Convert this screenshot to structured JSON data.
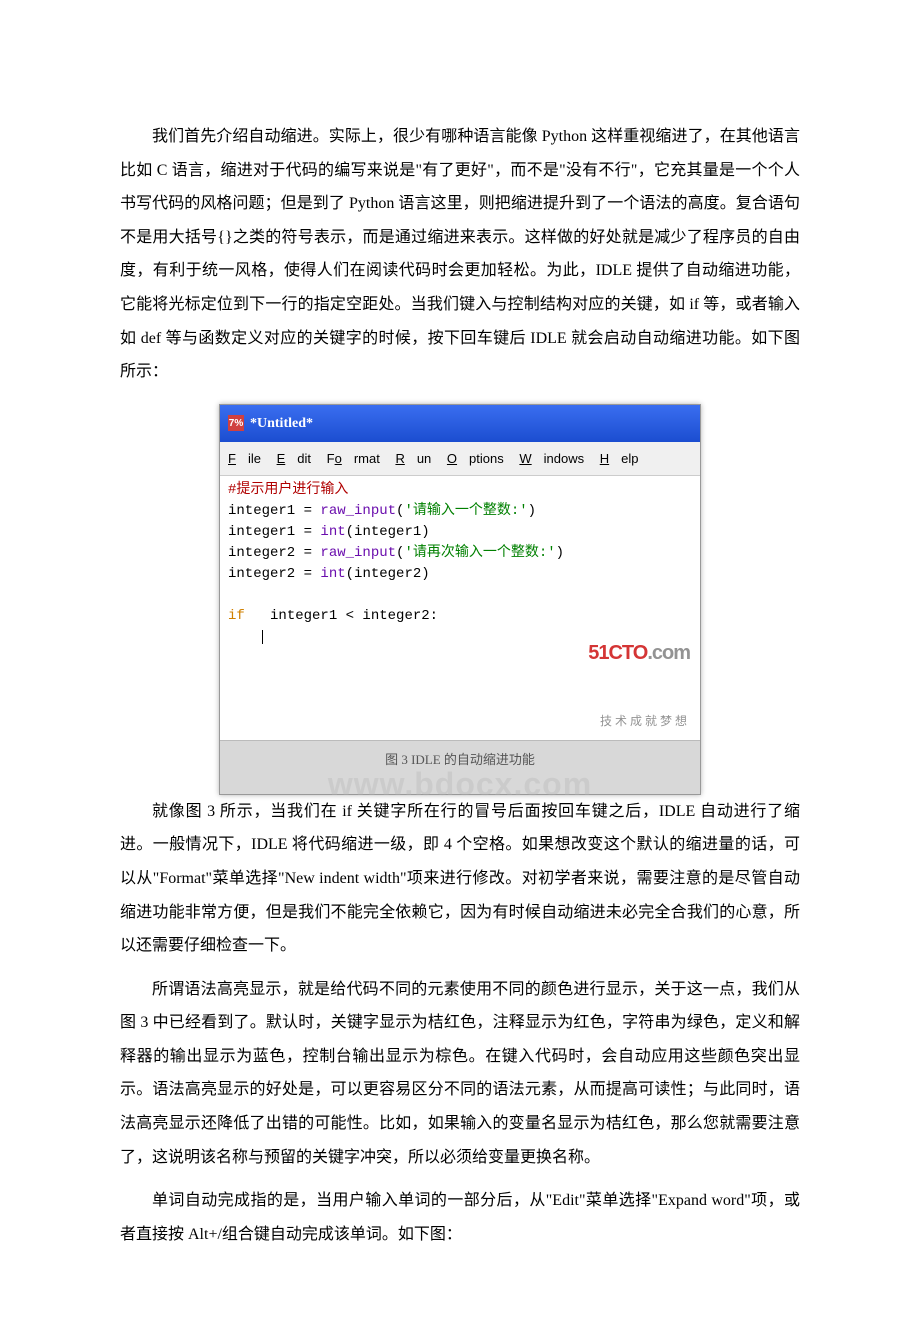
{
  "para1": "我们首先介绍自动缩进。实际上，很少有哪种语言能像 Python 这样重视缩进了，在其他语言比如 C 语言，缩进对于代码的编写来说是\"有了更好\"，而不是\"没有不行\"，它充其量是一个个人书写代码的风格问题；但是到了 Python 语言这里，则把缩进提升到了一个语法的高度。复合语句不是用大括号{}之类的符号表示，而是通过缩进来表示。这样做的好处就是减少了程序员的自由度，有利于统一风格，使得人们在阅读代码时会更加轻松。为此，IDLE 提供了自动缩进功能，它能将光标定位到下一行的指定空距处。当我们键入与控制结构对应的关键，如 if 等，或者输入如 def 等与函数定义对应的关键字的时候，按下回车键后 IDLE 就会启动自动缩进功能。如下图所示：",
  "idle": {
    "title": "*Untitled*",
    "menu": {
      "file": "File",
      "edit": "Edit",
      "format": "Format",
      "run": "Run",
      "options": "Options",
      "windows": "Windows",
      "help": "Help"
    },
    "code": {
      "comment": "#提示用户进行输入",
      "l2a": "integer1 = ",
      "l2b": "raw_input",
      "l2c": "(",
      "l2d": "'请输入一个整数:'",
      "l2e": ")",
      "l3a": "integer1 = ",
      "l3b": "int",
      "l3c": "(integer1)",
      "l4a": "integer2 = ",
      "l4b": "raw_input",
      "l4c": "(",
      "l4d": "'请再次输入一个整数:'",
      "l4e": ")",
      "l5a": "integer2 = ",
      "l5b": "int",
      "l5c": "(integer2)",
      "l7a": "if",
      "l7b": "   integer1 < integer2:"
    },
    "logo1a": "51CTO",
    "logo1b": ".com",
    "logo2": "技术成就梦想",
    "caption": "图 3    IDLE 的自动缩进功能",
    "watermark": "www.bdocx.com"
  },
  "para2": "就像图 3 所示，当我们在 if 关键字所在行的冒号后面按回车键之后，IDLE 自动进行了缩进。一般情况下，IDLE 将代码缩进一级，即 4 个空格。如果想改变这个默认的缩进量的话，可以从\"Format\"菜单选择\"New indent width\"项来进行修改。对初学者来说，需要注意的是尽管自动缩进功能非常方便，但是我们不能完全依赖它，因为有时候自动缩进未必完全合我们的心意，所以还需要仔细检查一下。",
  "para3": "所谓语法高亮显示，就是给代码不同的元素使用不同的颜色进行显示，关于这一点，我们从图 3 中已经看到了。默认时，关键字显示为桔红色，注释显示为红色，字符串为绿色，定义和解释器的输出显示为蓝色，控制台输出显示为棕色。在键入代码时，会自动应用这些颜色突出显示。语法高亮显示的好处是，可以更容易区分不同的语法元素，从而提高可读性；与此同时，语法高亮显示还降低了出错的可能性。比如，如果输入的变量名显示为桔红色，那么您就需要注意了，这说明该名称与预留的关键字冲突，所以必须给变量更换名称。",
  "para4": "单词自动完成指的是，当用户输入单词的一部分后，从\"Edit\"菜单选择\"Expand word\"项，或者直接按 Alt+/组合键自动完成该单词。如下图："
}
